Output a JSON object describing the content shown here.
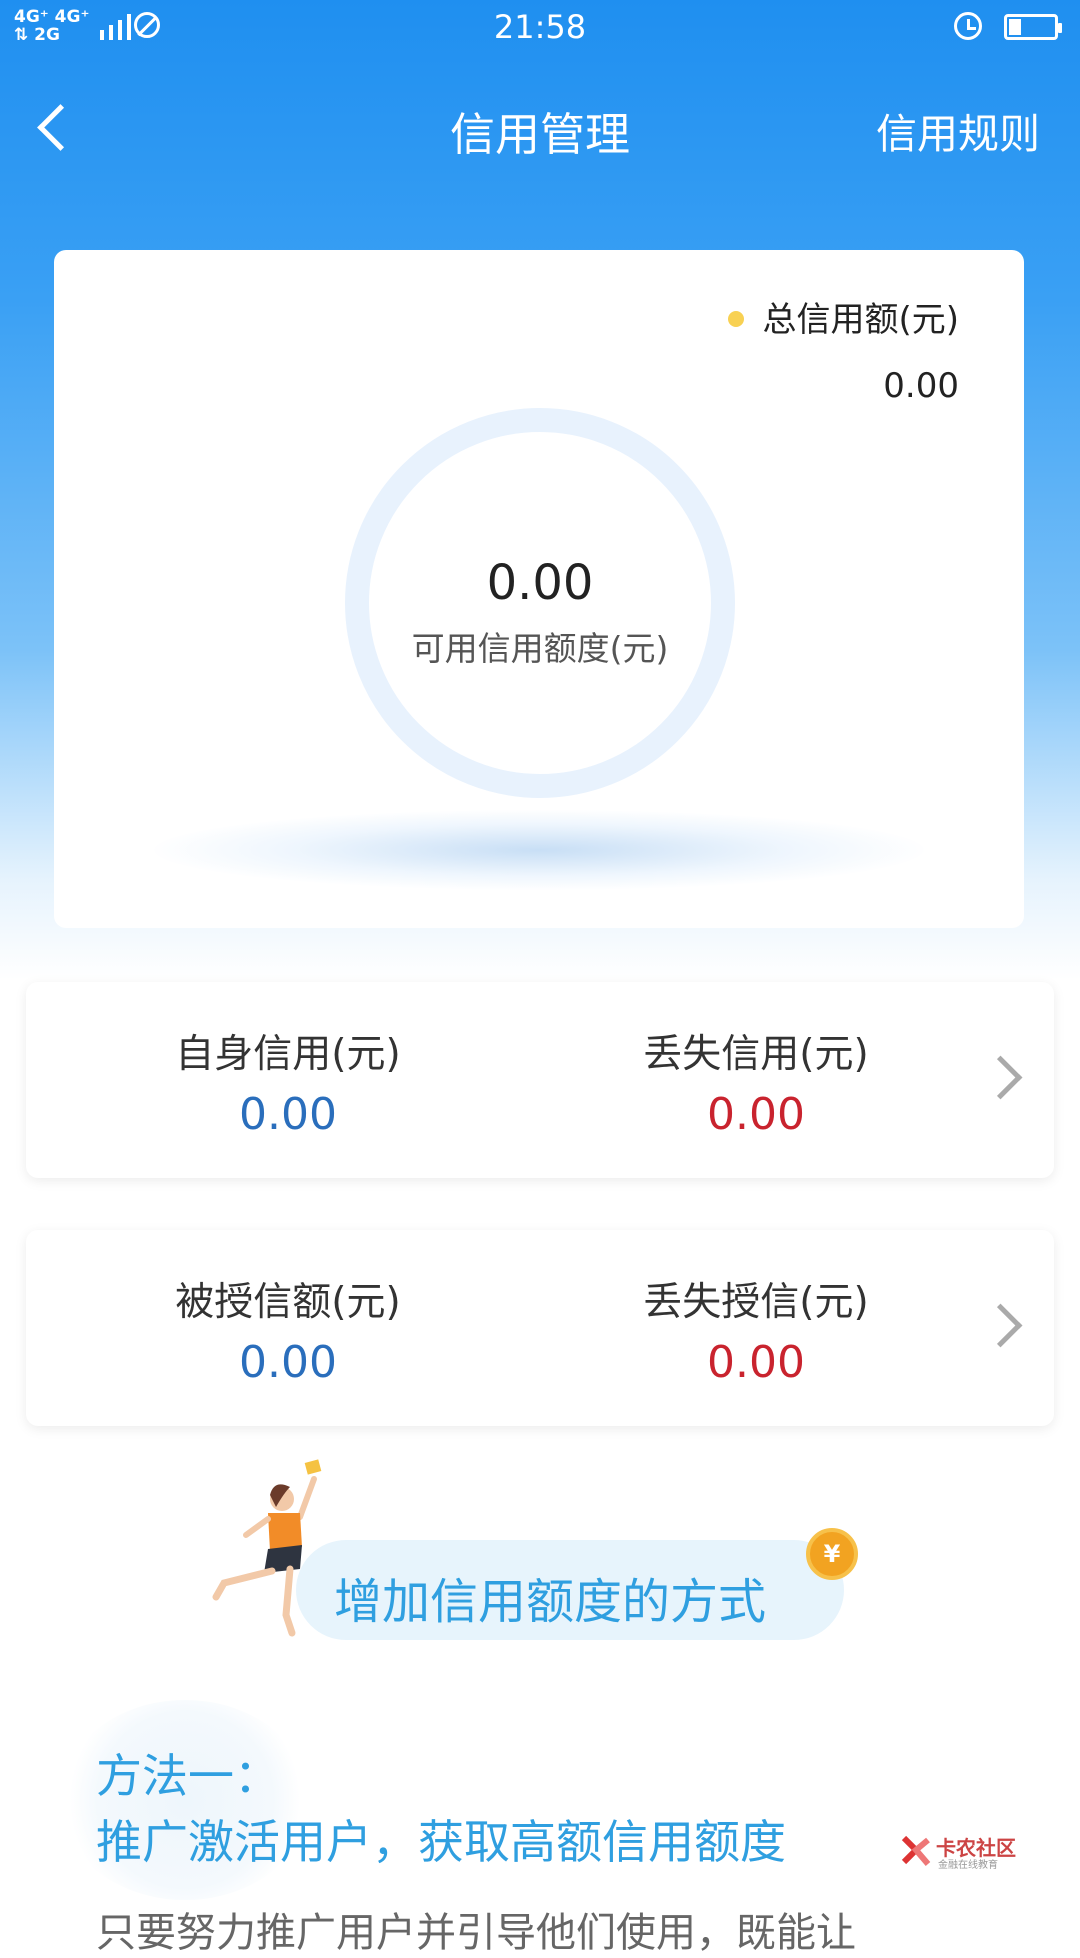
{
  "status_bar": {
    "network_top": "4G⁺ 4G⁺",
    "network_bottom": "⇅ 2G",
    "time": "21:58"
  },
  "header": {
    "title": "信用管理",
    "rules_label": "信用规则"
  },
  "summary": {
    "legend_label": "总信用额(元)",
    "total_value": "0.00",
    "available_value": "0.00",
    "available_label": "可用信用额度(元)"
  },
  "credit_card": {
    "own_label": "自身信用(元)",
    "own_value": "0.00",
    "lost_label": "丢失信用(元)",
    "lost_value": "0.00"
  },
  "grant_card": {
    "granted_label": "被授信额(元)",
    "granted_value": "0.00",
    "lost_grant_label": "丢失授信(元)",
    "lost_grant_value": "0.00"
  },
  "banner": {
    "text": "增加信用额度的方式",
    "coin_symbol": "¥"
  },
  "method": {
    "title": "方法一：",
    "desc": "推广激活用户，获取高额信用额度",
    "cut_text": "只要努力推广用户并引导他们使用，既能让"
  },
  "watermark": {
    "name": "卡农社区",
    "sub": "金融在线教育"
  },
  "colors": {
    "header_blue": "#1f8ff0",
    "value_blue": "#2a6ebc",
    "value_red": "#c9232e",
    "accent": "#2f9fe0",
    "legend_dot": "#f8d153"
  },
  "icons": [
    "signal-icon",
    "no-sim-icon",
    "alarm-icon",
    "battery-icon",
    "back-arrow-icon",
    "chevron-right-icon",
    "coin-icon",
    "runner-illustration"
  ]
}
